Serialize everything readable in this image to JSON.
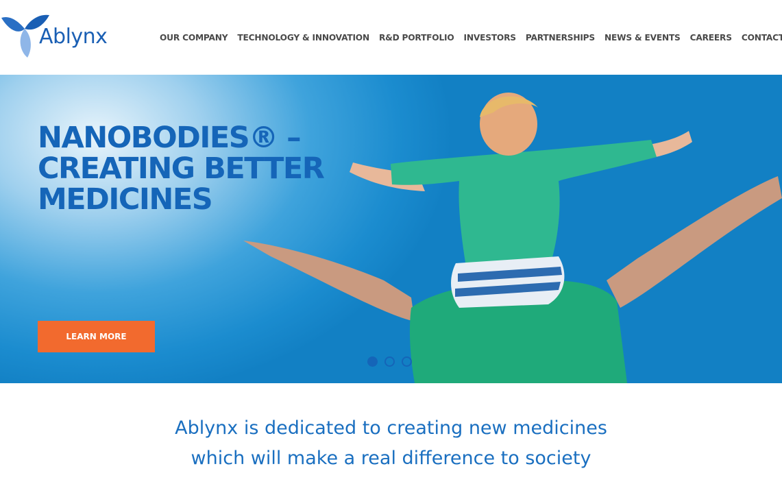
{
  "brand": {
    "name": "Ablynx",
    "primary_color": "#1565b8",
    "accent_color": "#f26a2e"
  },
  "nav": {
    "items": [
      {
        "label": "OUR COMPANY"
      },
      {
        "label": "TECHNOLOGY & INNOVATION"
      },
      {
        "label": "R&D PORTFOLIO"
      },
      {
        "label": "INVESTORS"
      },
      {
        "label": "PARTNERSHIPS"
      },
      {
        "label": "NEWS & EVENTS"
      },
      {
        "label": "CAREERS"
      },
      {
        "label": "CONTACT"
      }
    ]
  },
  "hero": {
    "title_lines": [
      "NANOBODIES® –",
      "CREATING BETTER",
      "MEDICINES"
    ],
    "cta_label": "LEARN MORE",
    "slides": {
      "count": 3,
      "active": 1
    }
  },
  "tagline": {
    "lines": [
      "Ablynx is dedicated to creating new medicines",
      "which will make a real difference to society"
    ]
  }
}
